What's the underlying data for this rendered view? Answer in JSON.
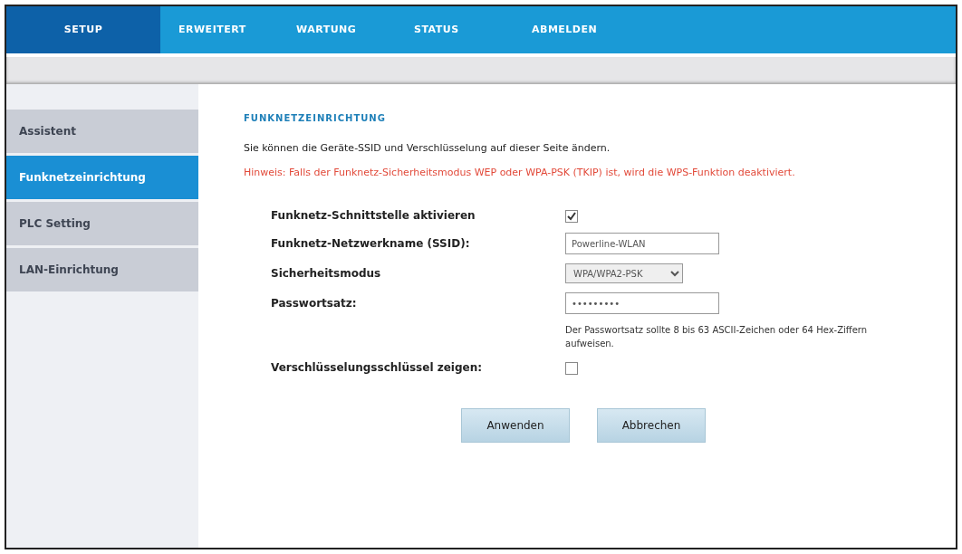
{
  "top_nav": [
    {
      "label": "SETUP",
      "selected": true
    },
    {
      "label": "ERWEITERT",
      "selected": false
    },
    {
      "label": "WARTUNG",
      "selected": false
    },
    {
      "label": "STATUS",
      "selected": false
    },
    {
      "label": "ABMELDEN",
      "selected": false
    }
  ],
  "sidebar": {
    "items": [
      {
        "label": "Assistent",
        "selected": false
      },
      {
        "label": "Funknetzeinrichtung",
        "selected": true
      },
      {
        "label": "PLC Setting",
        "selected": false
      },
      {
        "label": "LAN-Einrichtung",
        "selected": false
      }
    ]
  },
  "content": {
    "heading": "FUNKNETZEINRICHTUNG",
    "intro": "Sie können die Geräte-SSID und Verschlüsselung auf dieser Seite ändern.",
    "warning": "Hinweis: Falls der Funknetz-Sicherheitsmodus WEP oder WPA-PSK (TKIP) ist, wird die WPS-Funktion deaktiviert.",
    "form": [
      {
        "kind": "checkbox",
        "label": "Funknetz-Schnittstelle aktivieren",
        "checked": true
      },
      {
        "kind": "text",
        "label": "Funknetz-Netzwerkname (SSID):",
        "value": "Powerline-WLAN"
      },
      {
        "kind": "select",
        "label": "Sicherheitsmodus",
        "value": "WPA/WPA2-PSK"
      },
      {
        "kind": "text",
        "label": "Passwortsatz:",
        "value": "•••••••••"
      },
      {
        "kind": "note",
        "text": "Der Passwortsatz sollte 8 bis 63 ASCII-Zeichen oder 64 Hex-Ziffern aufweisen."
      },
      {
        "kind": "checkbox",
        "label": "Verschlüsselungsschlüssel zeigen:",
        "checked": false
      }
    ],
    "buttons": [
      "Anwenden",
      "Abbrechen"
    ]
  }
}
